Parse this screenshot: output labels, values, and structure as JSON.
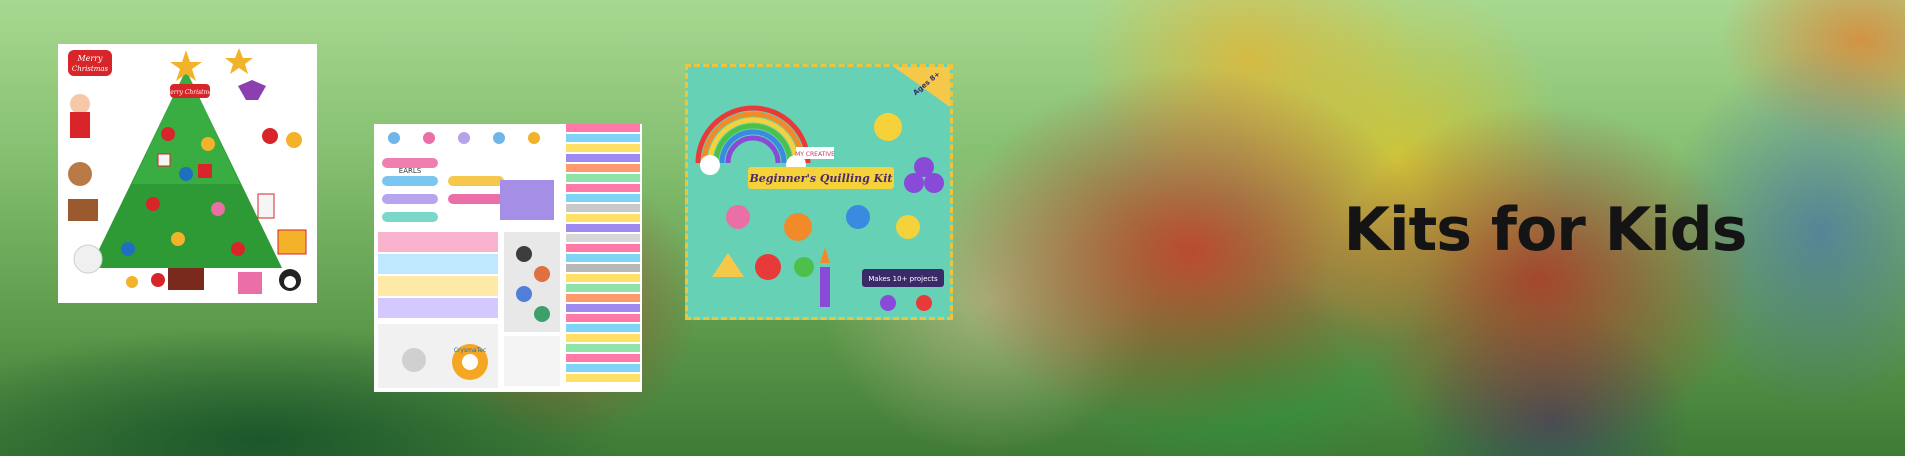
{
  "banner": {
    "heading": "Kits for Kids",
    "products": [
      {
        "id": "felt-christmas-tree-kit",
        "image_text": [
          "Merry",
          "Christmas",
          "Merry Christmas"
        ]
      },
      {
        "id": "bracelet-making-kit",
        "image_text": [
          "EARLS",
          "CrysmaTec"
        ]
      },
      {
        "id": "quilling-kit",
        "image_text": [
          "Ages 8+",
          "MY CREATIVE",
          "Beginner's Quilling Kit",
          "Makes 10+ projects"
        ]
      }
    ]
  }
}
